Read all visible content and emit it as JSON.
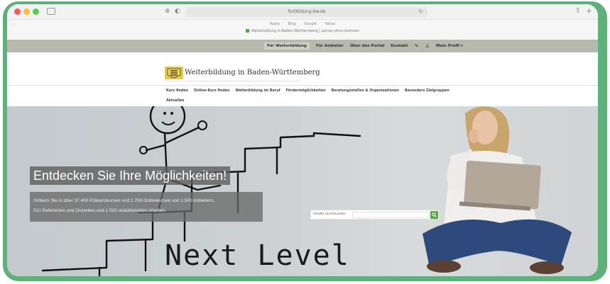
{
  "browser": {
    "url": "fortbildung-bw.de",
    "favorites": [
      "Apple",
      "Bing",
      "Google",
      "Yahoo"
    ],
    "tab_title": "Weiterbildung in Baden-Württemberg | Lernen ohne Grenzen"
  },
  "top_nav": {
    "items": [
      "Für Weiterbildung",
      "Für Anbieter",
      "Über das Portal",
      "Kontakt"
    ],
    "profile_label": "Mein Profil"
  },
  "site": {
    "logo_text": "Weiterbildung in Baden-Württemberg"
  },
  "main_nav": {
    "items": [
      "Kurs finden",
      "Online-Kurs finden",
      "Weiterbildung im Beruf",
      "Fördermöglichkeiten",
      "Beratungsstellen & Organisationen",
      "Besonders Zielgruppen"
    ],
    "second_row": "Aktuelles"
  },
  "hero": {
    "headline": "Entdecken Sie Ihre Möglichkeiten!",
    "subtext_line1": "Stöbern Sie in über 37.400 Präsenzkursen und 1.700 Onlinekursen von 1.500 Anbietern,",
    "subtext_line2": "510 Referenten und Dozenten und 1.020 redaktionellen Inhalten.",
    "drawing_text": "Next Level",
    "search_label": "Inhalte durchsuchen",
    "search_value": ""
  },
  "colors": {
    "frame_green": "#5fb07b",
    "nav_bar": "#b9b8ae",
    "search_button": "#5aa34a"
  },
  "icons": {
    "search_button": "search-icon",
    "share": "share-icon",
    "new_tab": "plus-icon",
    "pin": "pin-icon",
    "profile": "person-icon"
  }
}
